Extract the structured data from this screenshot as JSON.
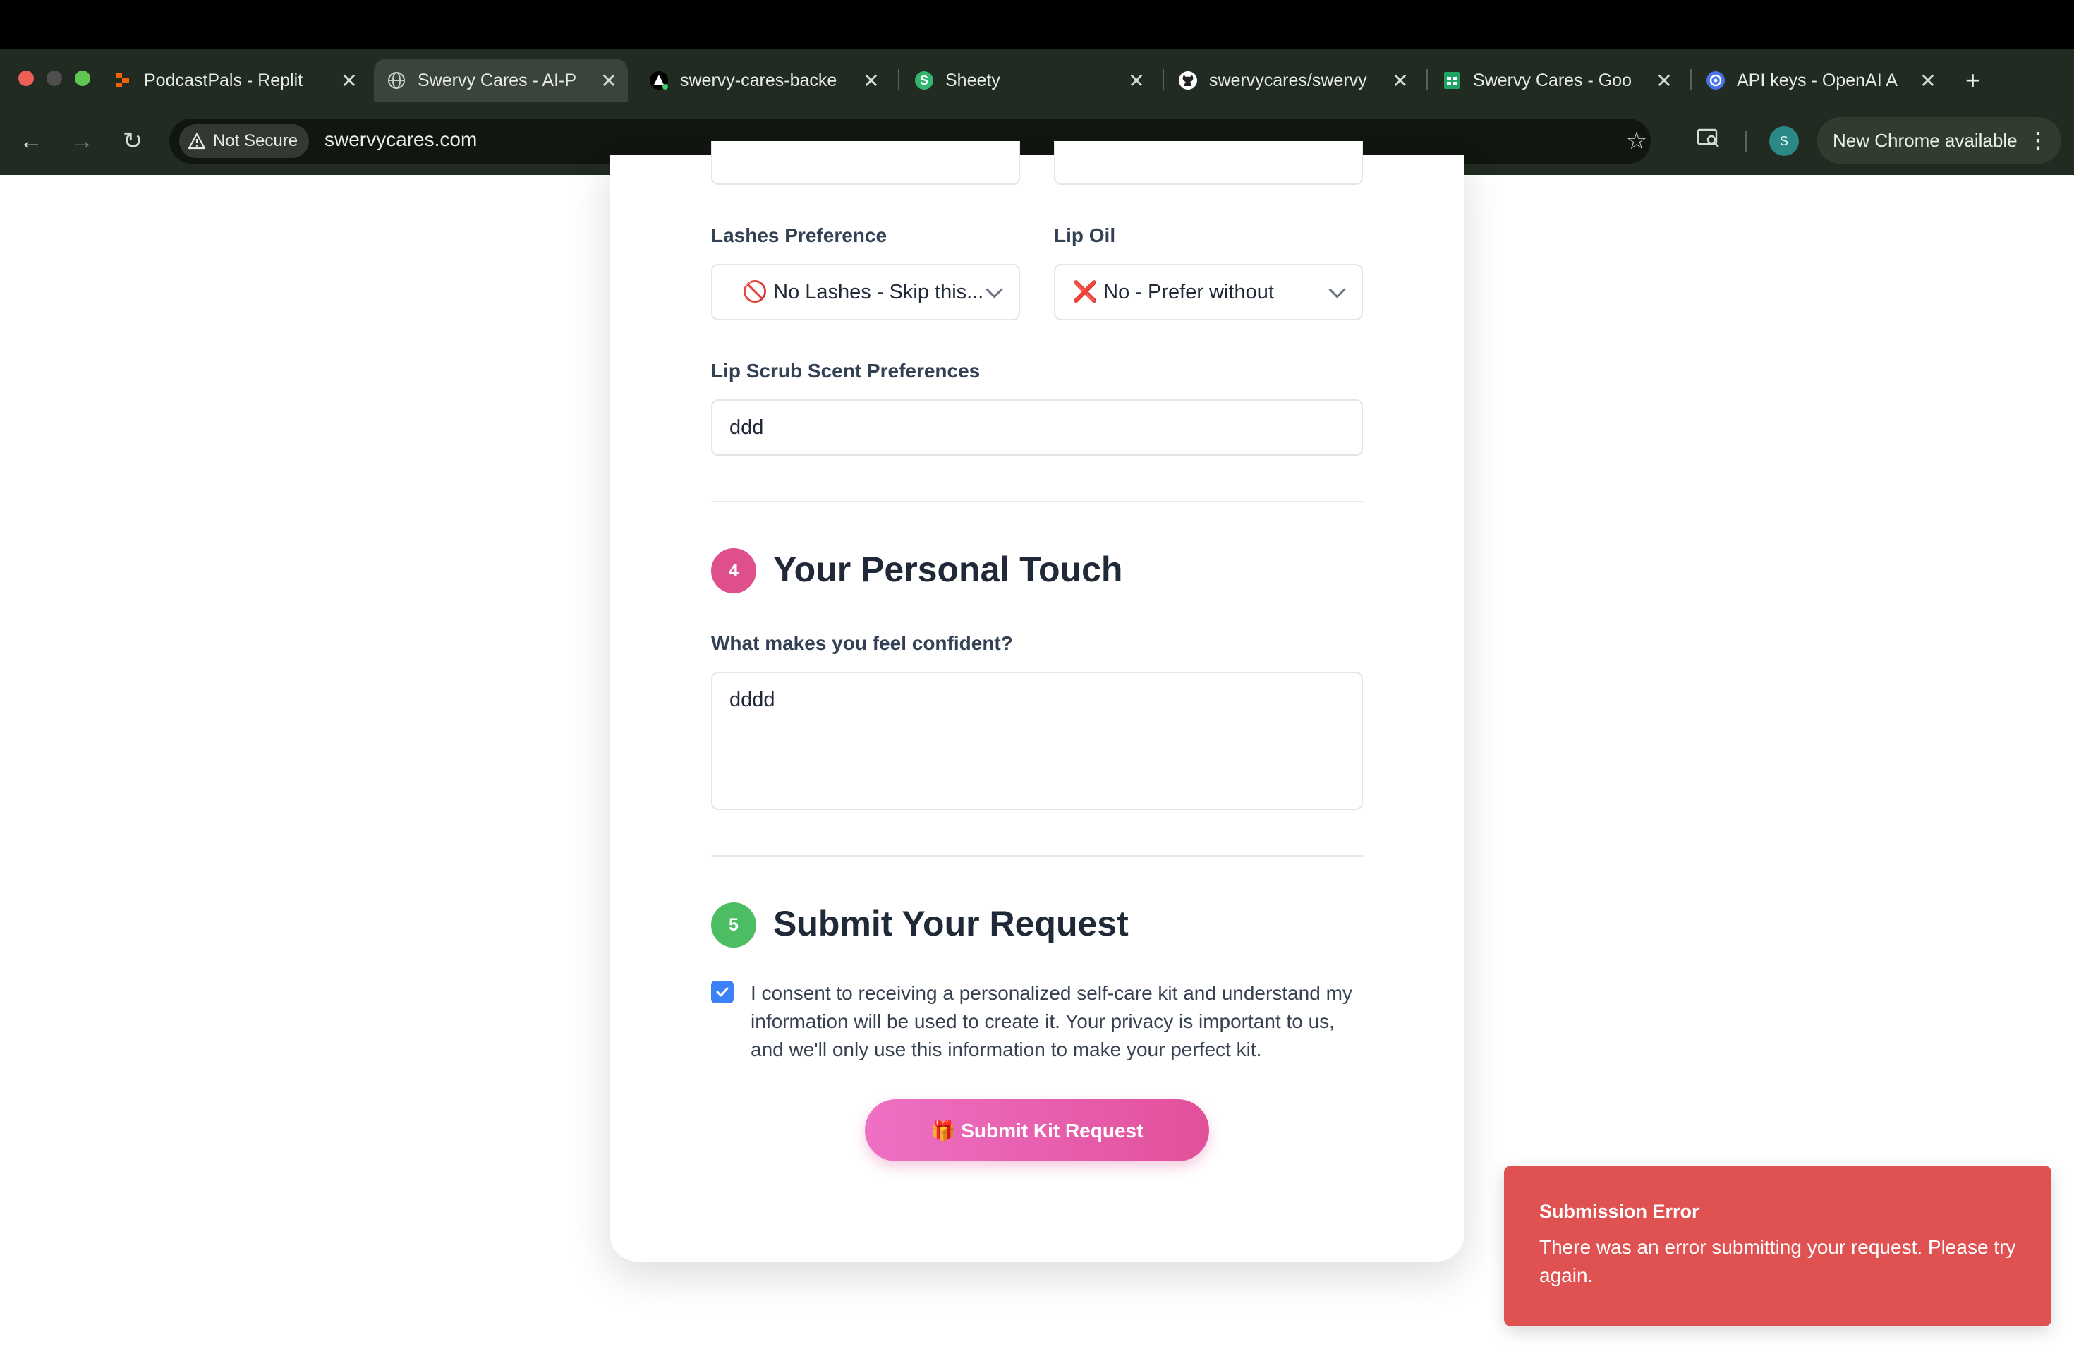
{
  "browser": {
    "tabs": [
      {
        "title": "PodcastPals - Replit",
        "icon": "replit-icon"
      },
      {
        "title": "Swervy Cares - AI-P",
        "icon": "globe-icon",
        "active": true
      },
      {
        "title": "swervy-cares-backe",
        "icon": "render-icon"
      },
      {
        "title": "Sheety",
        "icon": "sheety-icon"
      },
      {
        "title": "swervycares/swervy",
        "icon": "github-icon"
      },
      {
        "title": "Swervy Cares - Goo",
        "icon": "sheets-icon"
      },
      {
        "title": "API keys - OpenAI A",
        "icon": "openai-icon"
      }
    ],
    "security_label": "Not Secure",
    "url": "swervycares.com",
    "profile_initial": "S",
    "new_chrome_label": "New Chrome available"
  },
  "form": {
    "lashes": {
      "label": "Lashes Preference",
      "value": "🚫 No Lashes - Skip this..."
    },
    "lip_oil": {
      "label": "Lip Oil",
      "value": "❌ No - Prefer without"
    },
    "lip_scrub": {
      "label": "Lip Scrub Scent Preferences",
      "value": "ddd"
    },
    "section4": {
      "number": "4",
      "title": "Your Personal Touch",
      "color": "#de4f8c"
    },
    "confidence": {
      "label": "What makes you feel confident?",
      "value": "dddd"
    },
    "section5": {
      "number": "5",
      "title": "Submit Your Request",
      "color": "#4cbd63"
    },
    "consent_checked": true,
    "consent_text": "I consent to receiving a personalized self-care kit and understand my information will be used to create it. Your privacy is important to us, and we'll only use this information to make your perfect kit.",
    "submit_label": "🎁 Submit Kit Request"
  },
  "toast": {
    "title": "Submission Error",
    "message": "There was an error submitting your request. Please try again.",
    "color": "#e05252"
  }
}
